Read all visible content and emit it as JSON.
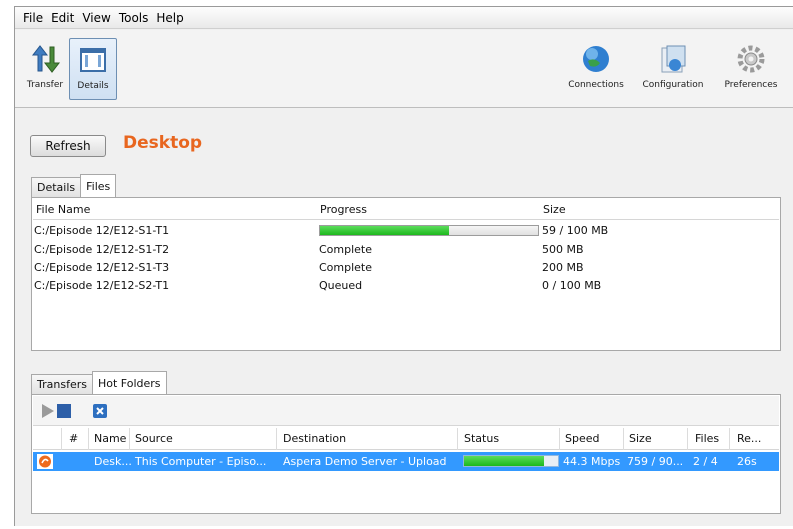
{
  "menu": [
    "File",
    "Edit",
    "View",
    "Tools",
    "Help"
  ],
  "toolbar": {
    "transfer_label": "Transfer",
    "details_label": "Details",
    "connections_label": "Connections",
    "configuration_label": "Configuration",
    "preferences_label": "Preferences",
    "accent": "#e8661f"
  },
  "refresh_label": "Refresh",
  "location_title": "Desktop",
  "top_tabs": [
    "Details",
    "Files"
  ],
  "files_table": {
    "headers": [
      "File Name",
      "Progress",
      "Size"
    ],
    "rows": [
      {
        "name": "C:/Episode 12/E12-S1-T1",
        "progress": "",
        "progress_fraction": 0.59,
        "size": "59 / 100 MB"
      },
      {
        "name": "C:/Episode 12/E12-S1-T2",
        "progress": "Complete",
        "size": "500 MB"
      },
      {
        "name": "C:/Episode 12/E12-S1-T3",
        "progress": "Complete",
        "size": "200 MB"
      },
      {
        "name": "C:/Episode 12/E12-S2-T1",
        "progress": "Queued",
        "size": "0 / 100 MB"
      }
    ]
  },
  "bottom_tabs": [
    "Transfers",
    "Hot Folders"
  ],
  "hot_folders": {
    "headers": [
      "#",
      "Name",
      "Source",
      "Destination",
      "Status",
      "Speed",
      "Size",
      "Files",
      "Re..."
    ],
    "row": {
      "name": "Desk...",
      "source": "This Computer - Episo...",
      "destination": "Aspera Demo Server - Upload",
      "status_fraction": 0.85,
      "speed": "44.3 Mbps",
      "size": "759 / 90...",
      "files": "2 / 4",
      "remaining": "26s"
    },
    "selection_color": "#3399ff"
  }
}
